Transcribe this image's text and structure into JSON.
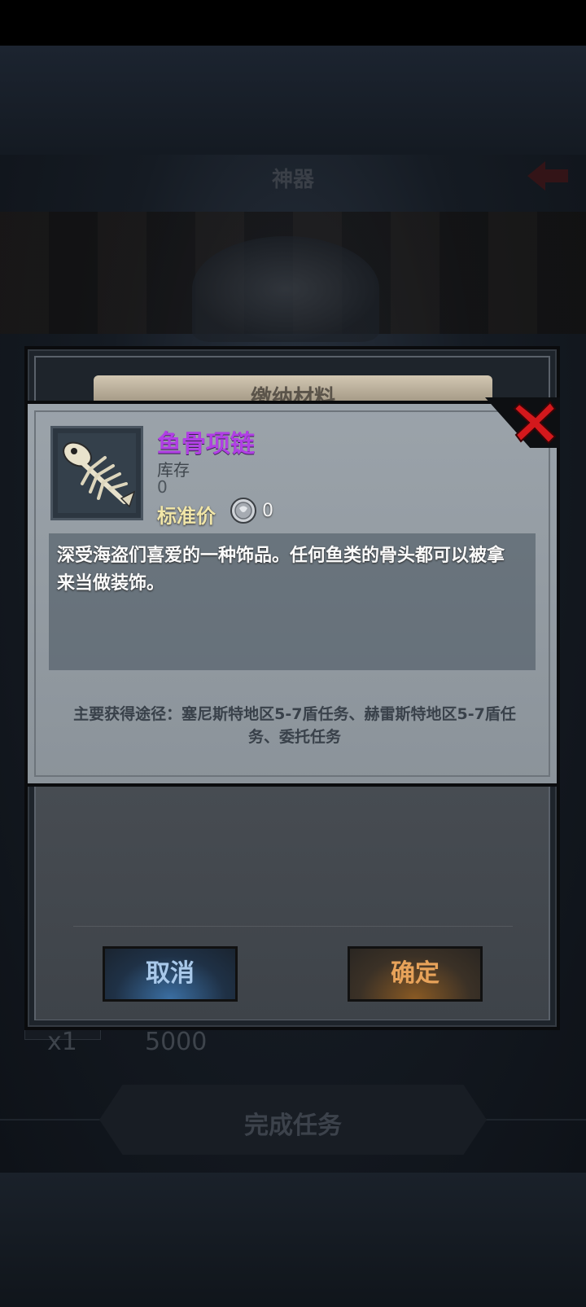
{
  "background": {
    "header_title": "神器",
    "reward": {
      "count": "x1",
      "amount": "5000"
    },
    "complete_button_label": "完成任务"
  },
  "dialog": {
    "title": "缴纳材料",
    "cancel_label": "取消",
    "confirm_label": "确定"
  },
  "item": {
    "name": "鱼骨项链",
    "stock_label": "库存",
    "stock_value": "0",
    "price_label": "标准价",
    "price_value": "0",
    "description": "深受海盗们喜爱的一种饰品。任何鱼类的骨头都可以被拿来当做装饰。",
    "source": "主要获得途径：塞尼斯特地区5-7盾任务、赫雷斯特地区5-7盾任务、委托任务",
    "icon": "fish-bone-necklace-icon",
    "name_color": "#b13fe5"
  },
  "colors": {
    "cancel_accent": "#3b6fa3",
    "confirm_accent": "#e8a35a",
    "close_accent": "#d4181c"
  }
}
